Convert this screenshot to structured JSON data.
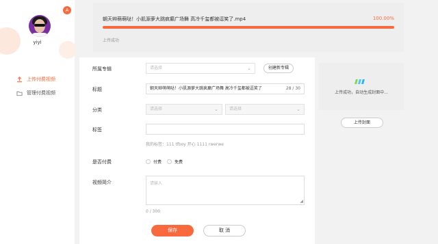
{
  "user": {
    "name": "yiyi",
    "badge": "A"
  },
  "sidebar": {
    "items": [
      {
        "label": "上传付费视频",
        "icon": "upload-icon",
        "active": true
      },
      {
        "label": "管理付费视频",
        "icon": "folder-icon",
        "active": false
      }
    ]
  },
  "upload": {
    "file_name": "朝天辫萌萌哒！小肌源萝大跳疯癫广场舞 高冷千玺都被逗笑了.mp4",
    "percent_label": "100.00%",
    "progress": 1.0,
    "status": "上传成功"
  },
  "form": {
    "album": {
      "label": "所属专辑",
      "placeholder": "请选择",
      "create_button": "创建新专辑"
    },
    "title": {
      "label": "标题",
      "value": "朝天辫萌萌哒！小肌源萝大跳疯癫广场舞 高冷千玺都被逗笑了",
      "count": "28 / 30"
    },
    "category": {
      "label": "分类",
      "placeholder_1": "请选择",
      "placeholder_2": "请选择"
    },
    "tags": {
      "label": "标签",
      "hint": "我的标签：111 tfboy 开心 1111 rwerwe"
    },
    "paid": {
      "label": "是否付费",
      "option_paid": "付费",
      "option_free": "免费"
    },
    "intro": {
      "label": "视频简介",
      "placeholder": "请输入",
      "count": "0 / 300"
    },
    "save_button": "保存",
    "cancel_button": "取 消"
  },
  "cover": {
    "status": "上传成功，自动生成封面中...",
    "upload_button": "上传封面"
  },
  "colors": {
    "accent": "#f86a3e",
    "loader": [
      "#7ed957",
      "#4fc3f7",
      "#29b6f6"
    ]
  }
}
